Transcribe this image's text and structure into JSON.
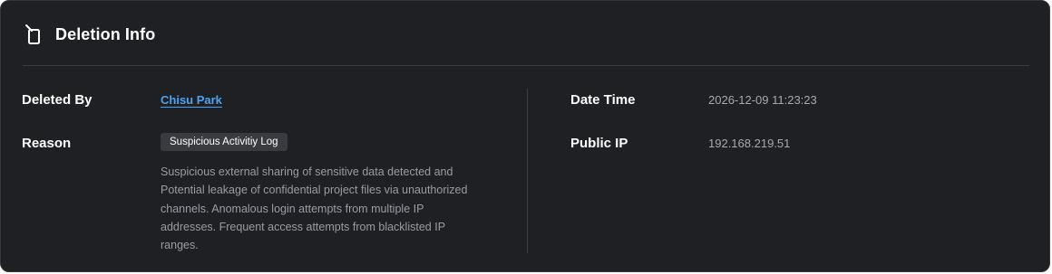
{
  "header": {
    "title": "Deletion Info",
    "icon": "trash-icon"
  },
  "left": {
    "deleted_by_label": "Deleted By",
    "deleted_by_value": "Chisu Park",
    "reason_label": "Reason",
    "reason_tag": "Suspicious Activitiy Log",
    "reason_description": "Suspicious external sharing of sensitive data detected and Potential leakage of confidential project files via unauthorized channels. Anomalous login attempts from multiple IP addresses. Frequent access attempts from blacklisted IP ranges."
  },
  "right": {
    "date_time_label": "Date Time",
    "date_time_value": "2026-12-09 11:23:23",
    "public_ip_label": "Public IP",
    "public_ip_value": "192.168.219.51"
  },
  "colors": {
    "background": "#1f2024",
    "link": "#4da3f2",
    "badge": "#3a3b40"
  }
}
